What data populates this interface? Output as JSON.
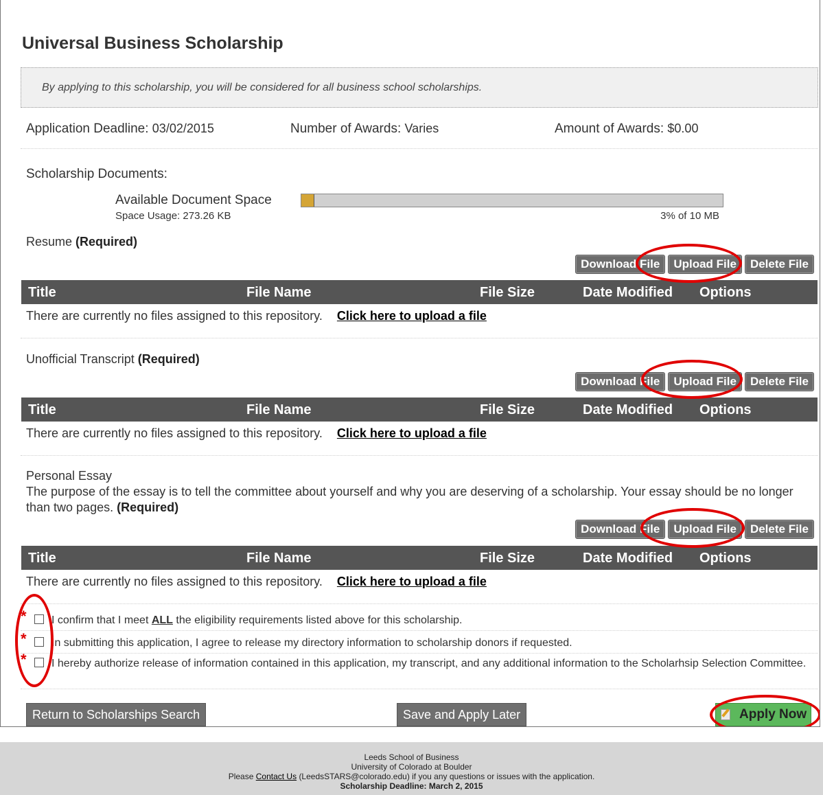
{
  "title": "Universal Business Scholarship",
  "intro": "By applying to this scholarship, you will be considered for all business school scholarships.",
  "meta": {
    "deadline_label": "Application Deadline:",
    "deadline_value": "03/02/2015",
    "awards_label": "Number of Awards:",
    "awards_value": "Varies",
    "amount_label": "Amount of Awards:",
    "amount_value": "$0.00"
  },
  "documents": {
    "heading": "Scholarship Documents:",
    "space_label": "Available Document Space",
    "space_usage": "Space Usage: 273.26 KB",
    "space_percent_text": "3% of 10 MB",
    "space_used_fraction": 0.03
  },
  "buttons": {
    "download": "Download File",
    "upload": "Upload File",
    "delete": "Delete File"
  },
  "table_headers": [
    "Title",
    "File Name",
    "File Size",
    "Date Modified",
    "Options"
  ],
  "empty_message": "There are currently no files assigned to this repository.",
  "upload_link": "Click here to upload a file",
  "sections": [
    {
      "name": "Resume",
      "required": "(Required)"
    },
    {
      "name": "Unofficial Transcript",
      "required": "(Required)"
    },
    {
      "name": "Personal Essay",
      "description": "The purpose of the essay is to tell the committee about yourself and why you are deserving of a scholarship. Your essay should be no longer than two pages.",
      "required": "(Required)"
    }
  ],
  "agreements": [
    {
      "prefix": "I confirm that I meet ",
      "emphasis": "ALL",
      "suffix": " the eligibility requirements listed above for this scholarship."
    },
    {
      "text": "In submitting this application, I agree to release my directory information to scholarship donors if requested."
    },
    {
      "text": "I hereby authorize release of information contained in this application, my transcript, and any additional information to the Scholarhsip Selection Committee."
    }
  ],
  "actions": {
    "return": "Return to Scholarships Search",
    "save": "Save and Apply Later",
    "apply": "Apply Now"
  },
  "footer": {
    "line1": "Leeds School of Business",
    "line2": "University of Colorado at Boulder",
    "line3_prefix": "Please",
    "contact_link": "Contact Us",
    "line3_suffix": "(LeedsSTARS@colorado.edu) if you any questions or issues with the application.",
    "line4": "Scholarship Deadline: March 2, 2015"
  },
  "colors": {
    "header_bar": "#555555",
    "button_gray": "#6c6c6c",
    "apply_green": "#5cb85c",
    "space_fill": "#d4a536",
    "annotation_red": "#e00000"
  }
}
